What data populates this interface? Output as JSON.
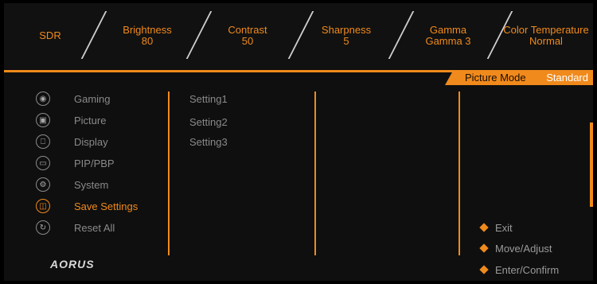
{
  "top_bar": {
    "items": [
      {
        "label": "SDR",
        "value": ""
      },
      {
        "label": "Brightness",
        "value": "80"
      },
      {
        "label": "Contrast",
        "value": "50"
      },
      {
        "label": "Sharpness",
        "value": "5"
      },
      {
        "label": "Gamma",
        "value": "Gamma 3"
      },
      {
        "label": "Color Temperature",
        "value": "Normal"
      }
    ]
  },
  "picture_mode": {
    "label": "Picture Mode",
    "value": "Standard"
  },
  "menu": {
    "items": [
      {
        "label": "Gaming",
        "icon": "gamepad-icon"
      },
      {
        "label": "Picture",
        "icon": "picture-icon"
      },
      {
        "label": "Display",
        "icon": "display-icon"
      },
      {
        "label": "PIP/PBP",
        "icon": "pip-icon"
      },
      {
        "label": "System",
        "icon": "gear-icon"
      },
      {
        "label": "Save Settings",
        "icon": "save-icon"
      },
      {
        "label": "Reset All",
        "icon": "reset-icon"
      }
    ],
    "active": "Save Settings"
  },
  "submenu": {
    "items": [
      "Setting1",
      "Setting2",
      "Setting3"
    ]
  },
  "hints": [
    {
      "label": "Exit",
      "icon": "joystick-left-icon"
    },
    {
      "label": "Move/Adjust",
      "icon": "joystick-updown-icon"
    },
    {
      "label": "Enter/Confirm",
      "icon": "joystick-press-icon"
    }
  ],
  "brand": {
    "logo": "AORUS"
  },
  "colors": {
    "accent": "#f08a1c",
    "background": "#0f0f0f"
  }
}
